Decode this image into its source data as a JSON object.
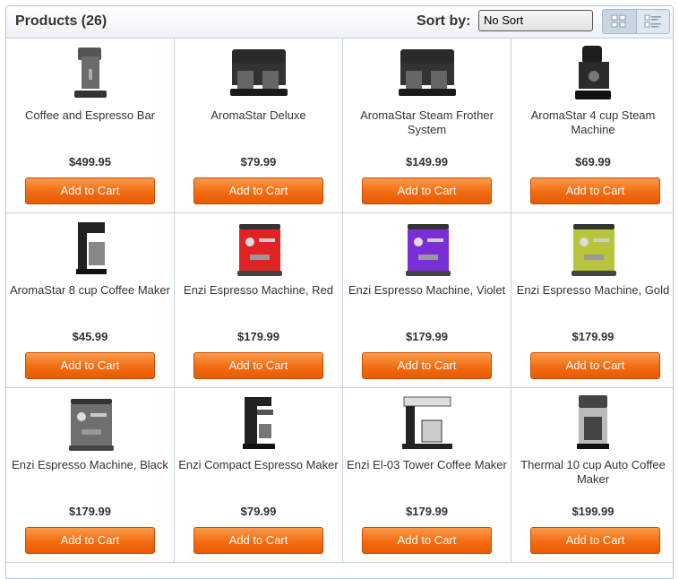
{
  "header": {
    "title": "Products (26)",
    "sort_label": "Sort by:",
    "sort_value": "No Sort"
  },
  "colors": {
    "button": "#f26c12",
    "border": "#c7d2dd"
  },
  "products": [
    {
      "name": "Coffee and Espresso Bar",
      "price": "$499.95",
      "button": "Add to Cart",
      "icon": "espresso-bar",
      "color": "#6b6b6b"
    },
    {
      "name": "AromaStar Deluxe",
      "price": "$79.99",
      "button": "Add to Cart",
      "icon": "dual-brewer",
      "color": "#2a2a2a"
    },
    {
      "name": "AromaStar Steam Frother System",
      "price": "$149.99",
      "button": "Add to Cart",
      "icon": "dual-brewer",
      "color": "#2a2a2a"
    },
    {
      "name": "AromaStar 4 cup Steam Machine",
      "price": "$69.99",
      "button": "Add to Cart",
      "icon": "steam-machine",
      "color": "#1e1e1e"
    },
    {
      "name": "AromaStar 8 cup Coffee Maker",
      "price": "$45.99",
      "button": "Add to Cart",
      "icon": "drip-maker",
      "color": "#222222"
    },
    {
      "name": "Enzi Espresso Machine, Red",
      "price": "$179.99",
      "button": "Add to Cart",
      "icon": "espresso-machine",
      "color": "#e02424"
    },
    {
      "name": "Enzi Espresso Machine, Violet",
      "price": "$179.99",
      "button": "Add to Cart",
      "icon": "espresso-machine",
      "color": "#7a2fd6"
    },
    {
      "name": "Enzi Espresso Machine, Gold",
      "price": "$179.99",
      "button": "Add to Cart",
      "icon": "espresso-machine",
      "color": "#b8c43a"
    },
    {
      "name": "Enzi Espresso Machine, Black",
      "price": "$179.99",
      "button": "Add to Cart",
      "icon": "espresso-machine",
      "color": "#6f6f6f"
    },
    {
      "name": "Enzi Compact Espresso Maker",
      "price": "$79.99",
      "button": "Add to Cart",
      "icon": "compact-espresso",
      "color": "#222222"
    },
    {
      "name": "Enzi El-03 Tower Coffee Maker",
      "price": "$179.99",
      "button": "Add to Cart",
      "icon": "tower-maker",
      "color": "#222222"
    },
    {
      "name": "Thermal 10 cup Auto Coffee Maker",
      "price": "$199.99",
      "button": "Add to Cart",
      "icon": "thermal-maker",
      "color": "#444444"
    }
  ]
}
